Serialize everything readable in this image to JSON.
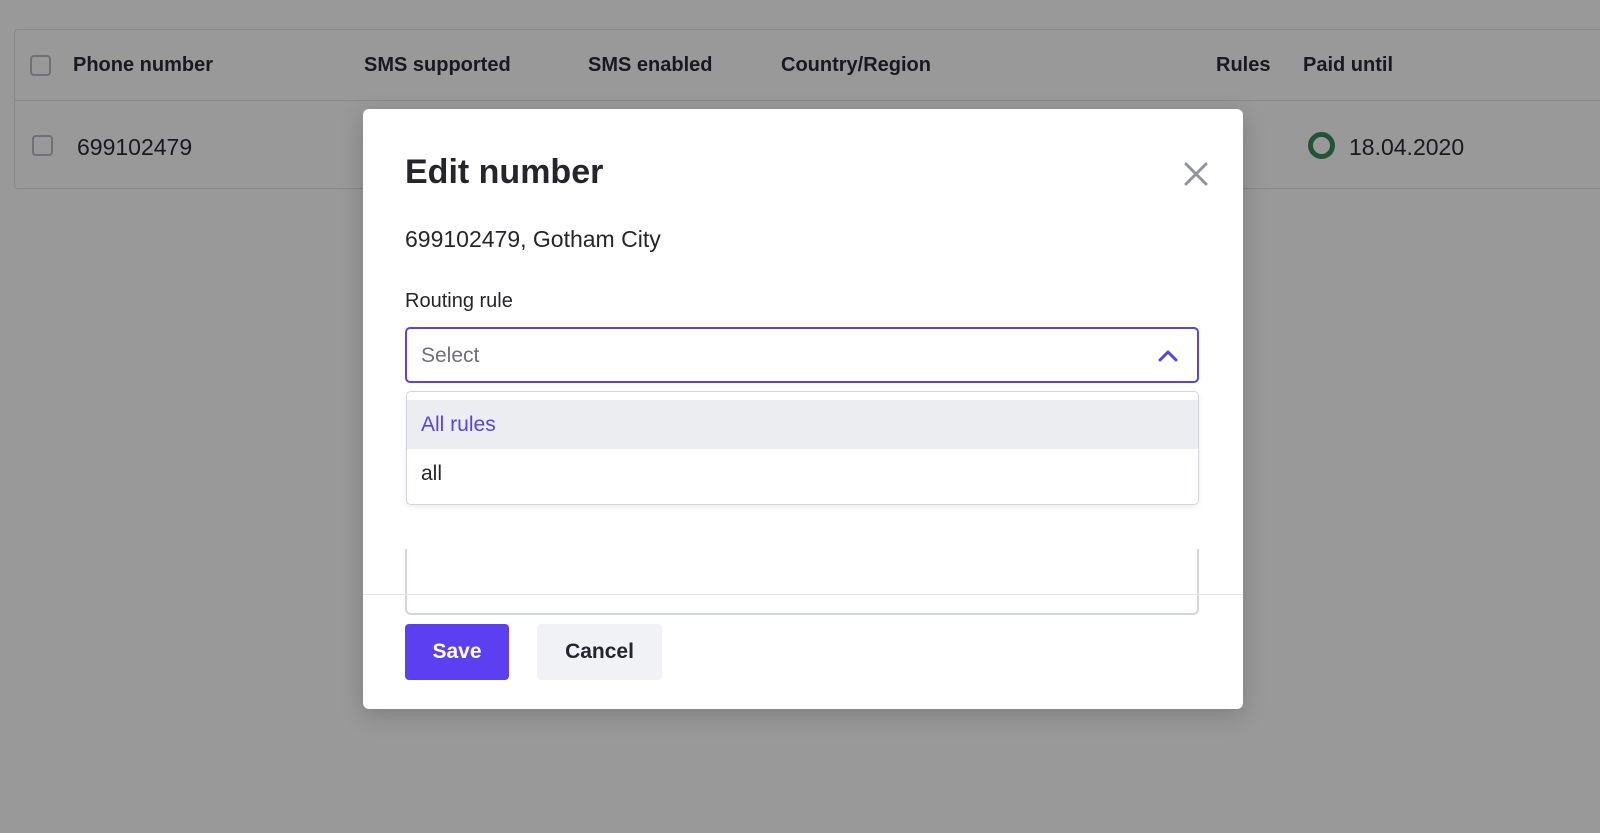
{
  "table": {
    "headers": [
      "Phone number",
      "SMS supported",
      "SMS enabled",
      "Country/Region",
      "Rules",
      "Paid until"
    ],
    "rows": [
      {
        "phone": "699102479",
        "paid_until": "18.04.2020",
        "status_color": "#3b8a5d"
      }
    ]
  },
  "modal": {
    "title": "Edit number",
    "subtitle": "699102479, Gotham City",
    "routing_label": "Routing rule",
    "select_placeholder": "Select",
    "dropdown_open": true,
    "options": [
      "All rules",
      "all"
    ],
    "highlighted_option": "All rules",
    "save_label": "Save",
    "cancel_label": "Cancel",
    "accent_color": "#5b3ff0"
  }
}
